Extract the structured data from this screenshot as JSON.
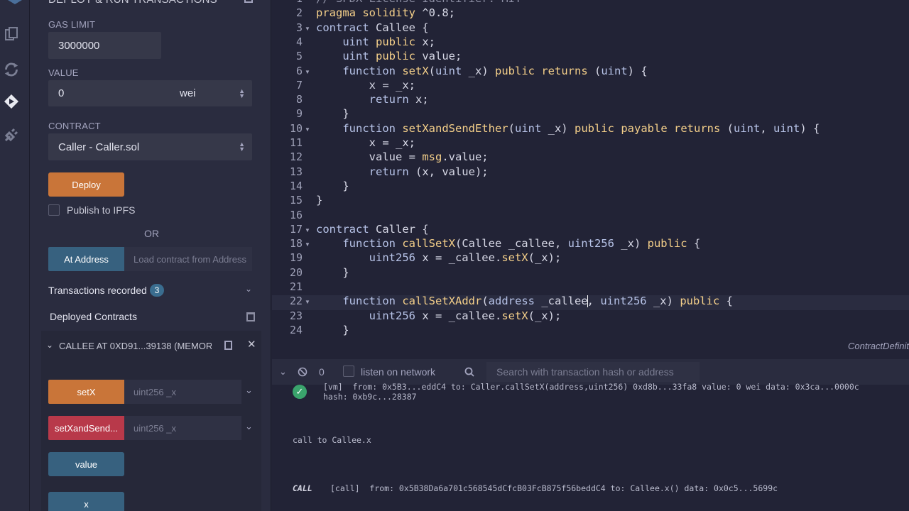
{
  "rail": {
    "icons": [
      "file-explorer-icon",
      "compiler-icon",
      "deploy-run-icon",
      "plugin-icon"
    ]
  },
  "panel": {
    "header_title": "DEPLOY & RUN TRANSACTIONS",
    "gas_limit_label": "GAS LIMIT",
    "gas_limit_value": "3000000",
    "value_label": "VALUE",
    "value_amount": "0",
    "value_unit": "wei",
    "contract_label": "CONTRACT",
    "contract_selected": "Caller - Caller.sol",
    "deploy_label": "Deploy",
    "publish_ipfs_label": "Publish to IPFS",
    "or_label": "OR",
    "at_address_label": "At Address",
    "load_contract_placeholder": "Load contract from Address",
    "transactions_recorded_label": "Transactions recorded",
    "transactions_recorded_count": "3",
    "deployed_contracts_label": "Deployed Contracts",
    "instance_title": "CALLEE AT 0XD91...39138 (MEMOR",
    "functions": [
      {
        "label": "setX",
        "placeholder": "uint256 _x"
      },
      {
        "label": "setXandSend...",
        "placeholder": "uint256 _x"
      },
      {
        "label": "value"
      },
      {
        "label": "x"
      }
    ]
  },
  "editor": {
    "line_numbers": [
      "1",
      "2",
      "3",
      "4",
      "5",
      "6",
      "7",
      "8",
      "9",
      "10",
      "11",
      "12",
      "13",
      "14",
      "15",
      "16",
      "17",
      "18",
      "19",
      "20",
      "21",
      "22",
      "23",
      "24"
    ],
    "lines": [
      "// SPDX-License-Identifier: MIT",
      "pragma solidity ^0.8;",
      "contract Callee {",
      "    uint public x;",
      "    uint public value;",
      "    function setX(uint _x) public returns (uint) {",
      "        x = _x;",
      "        return x;",
      "    }",
      "    function setXandSendEther(uint _x) public payable returns (uint, uint) {",
      "        x = _x;",
      "        value = msg.value;",
      "        return (x, value);",
      "    }",
      "}",
      "",
      "contract Caller {",
      "    function callSetX(Callee _callee, uint256 _x) public {",
      "        uint256 x = _callee.setX(_x);",
      "    }",
      "",
      "    function callSetXAddr(address _callee, uint256 _x) public {",
      "        uint256 x = _callee.setX(_x);",
      "    }"
    ],
    "status_right": "ContractDefinit"
  },
  "terminal_bar": {
    "count": "0",
    "listen_label": "listen on network",
    "search_placeholder": "Search with transaction hash or address"
  },
  "terminal": {
    "line1": "[vm]  from: 0x5B3...eddC4 to: Caller.callSetX(address,uint256) 0xd8b...33fa8 value: 0 wei data: 0x3ca...0000c",
    "line2": "hash: 0xb9c...28387",
    "call_to": "call to Callee.x",
    "call_tag": "CALL",
    "call_line": "[call]  from: 0x5B38Da6a701c568545dCfcB03FcB875f56beddC4 to: Callee.x() data: 0x0c5...5699c"
  }
}
